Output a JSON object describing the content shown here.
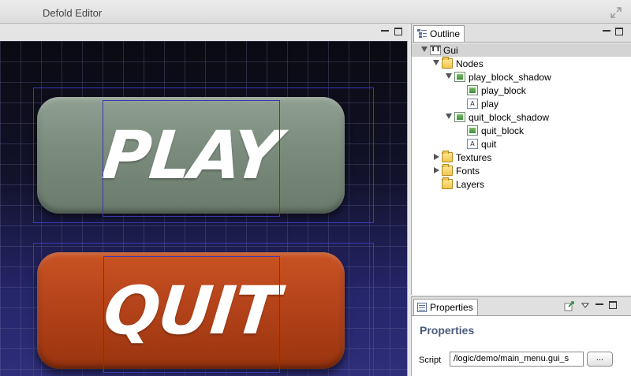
{
  "window": {
    "title": "Defold Editor"
  },
  "canvas": {
    "buttons": [
      {
        "label": "PLAY",
        "color": "#7b8c7d"
      },
      {
        "label": "QUIT",
        "color": "#b5431a"
      }
    ]
  },
  "outline": {
    "tab_label": "Outline",
    "tree": [
      {
        "label": "Gui",
        "icon": "gui-icon",
        "expanded": true,
        "selected": true
      },
      {
        "label": "Nodes",
        "icon": "folder-icon",
        "expanded": true
      },
      {
        "label": "play_block_shadow",
        "icon": "image-node-icon",
        "expanded": true
      },
      {
        "label": "play_block",
        "icon": "image-node-icon"
      },
      {
        "label": "play",
        "icon": "text-node-icon"
      },
      {
        "label": "quit_block_shadow",
        "icon": "image-node-icon",
        "expanded": true
      },
      {
        "label": "quit_block",
        "icon": "image-node-icon"
      },
      {
        "label": "quit",
        "icon": "text-node-icon"
      },
      {
        "label": "Textures",
        "icon": "folder-icon",
        "expanded": false
      },
      {
        "label": "Fonts",
        "icon": "folder-icon",
        "expanded": false
      },
      {
        "label": "Layers",
        "icon": "folder-icon"
      }
    ]
  },
  "properties": {
    "tab_label": "Properties",
    "heading": "Properties",
    "script_label": "Script",
    "script_value": "/logic/demo/main_menu.gui_s",
    "browse_label": "..."
  }
}
